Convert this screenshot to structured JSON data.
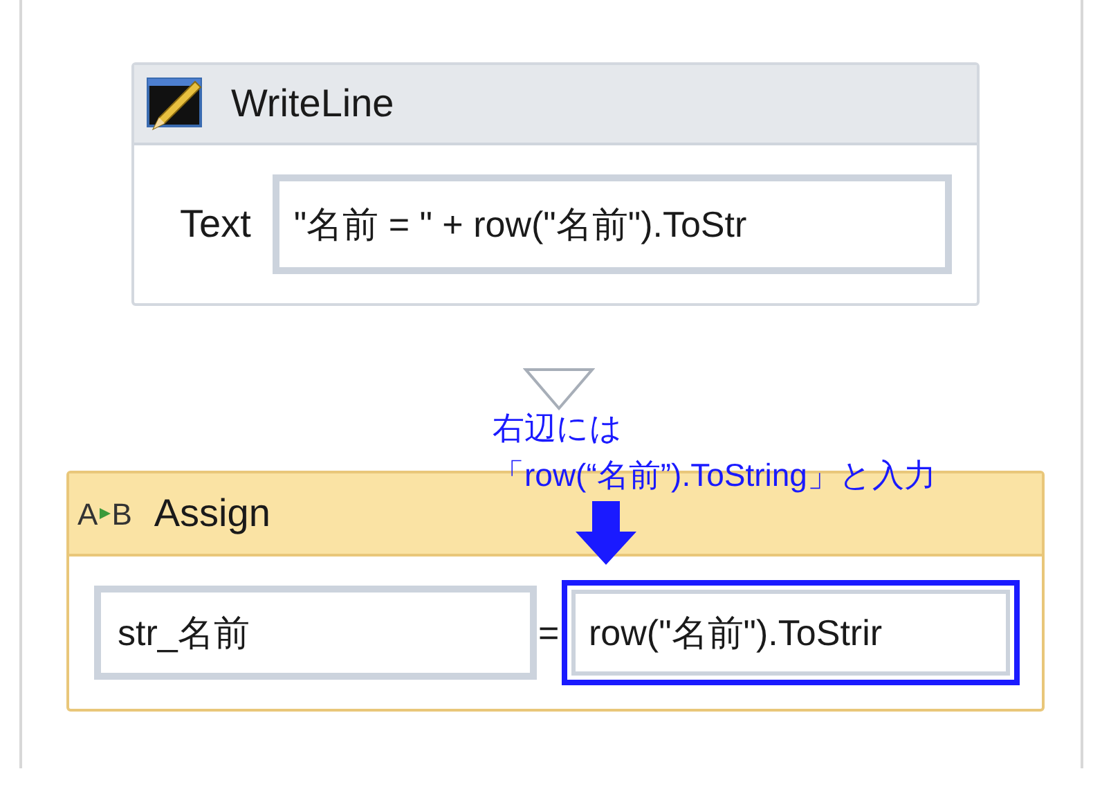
{
  "writeline": {
    "title": "WriteLine",
    "label": "Text",
    "value": "\"名前 = \" + row(\"名前\").ToStr"
  },
  "annotation": {
    "lines": [
      "右辺には",
      "「row(“名前”).ToString」と入力"
    ]
  },
  "assign": {
    "title": "Assign",
    "icon_letters": [
      "A",
      "B"
    ],
    "to": "str_名前",
    "operator": "=",
    "value": "row(\"名前\").ToStrir",
    "highlighted": true
  }
}
